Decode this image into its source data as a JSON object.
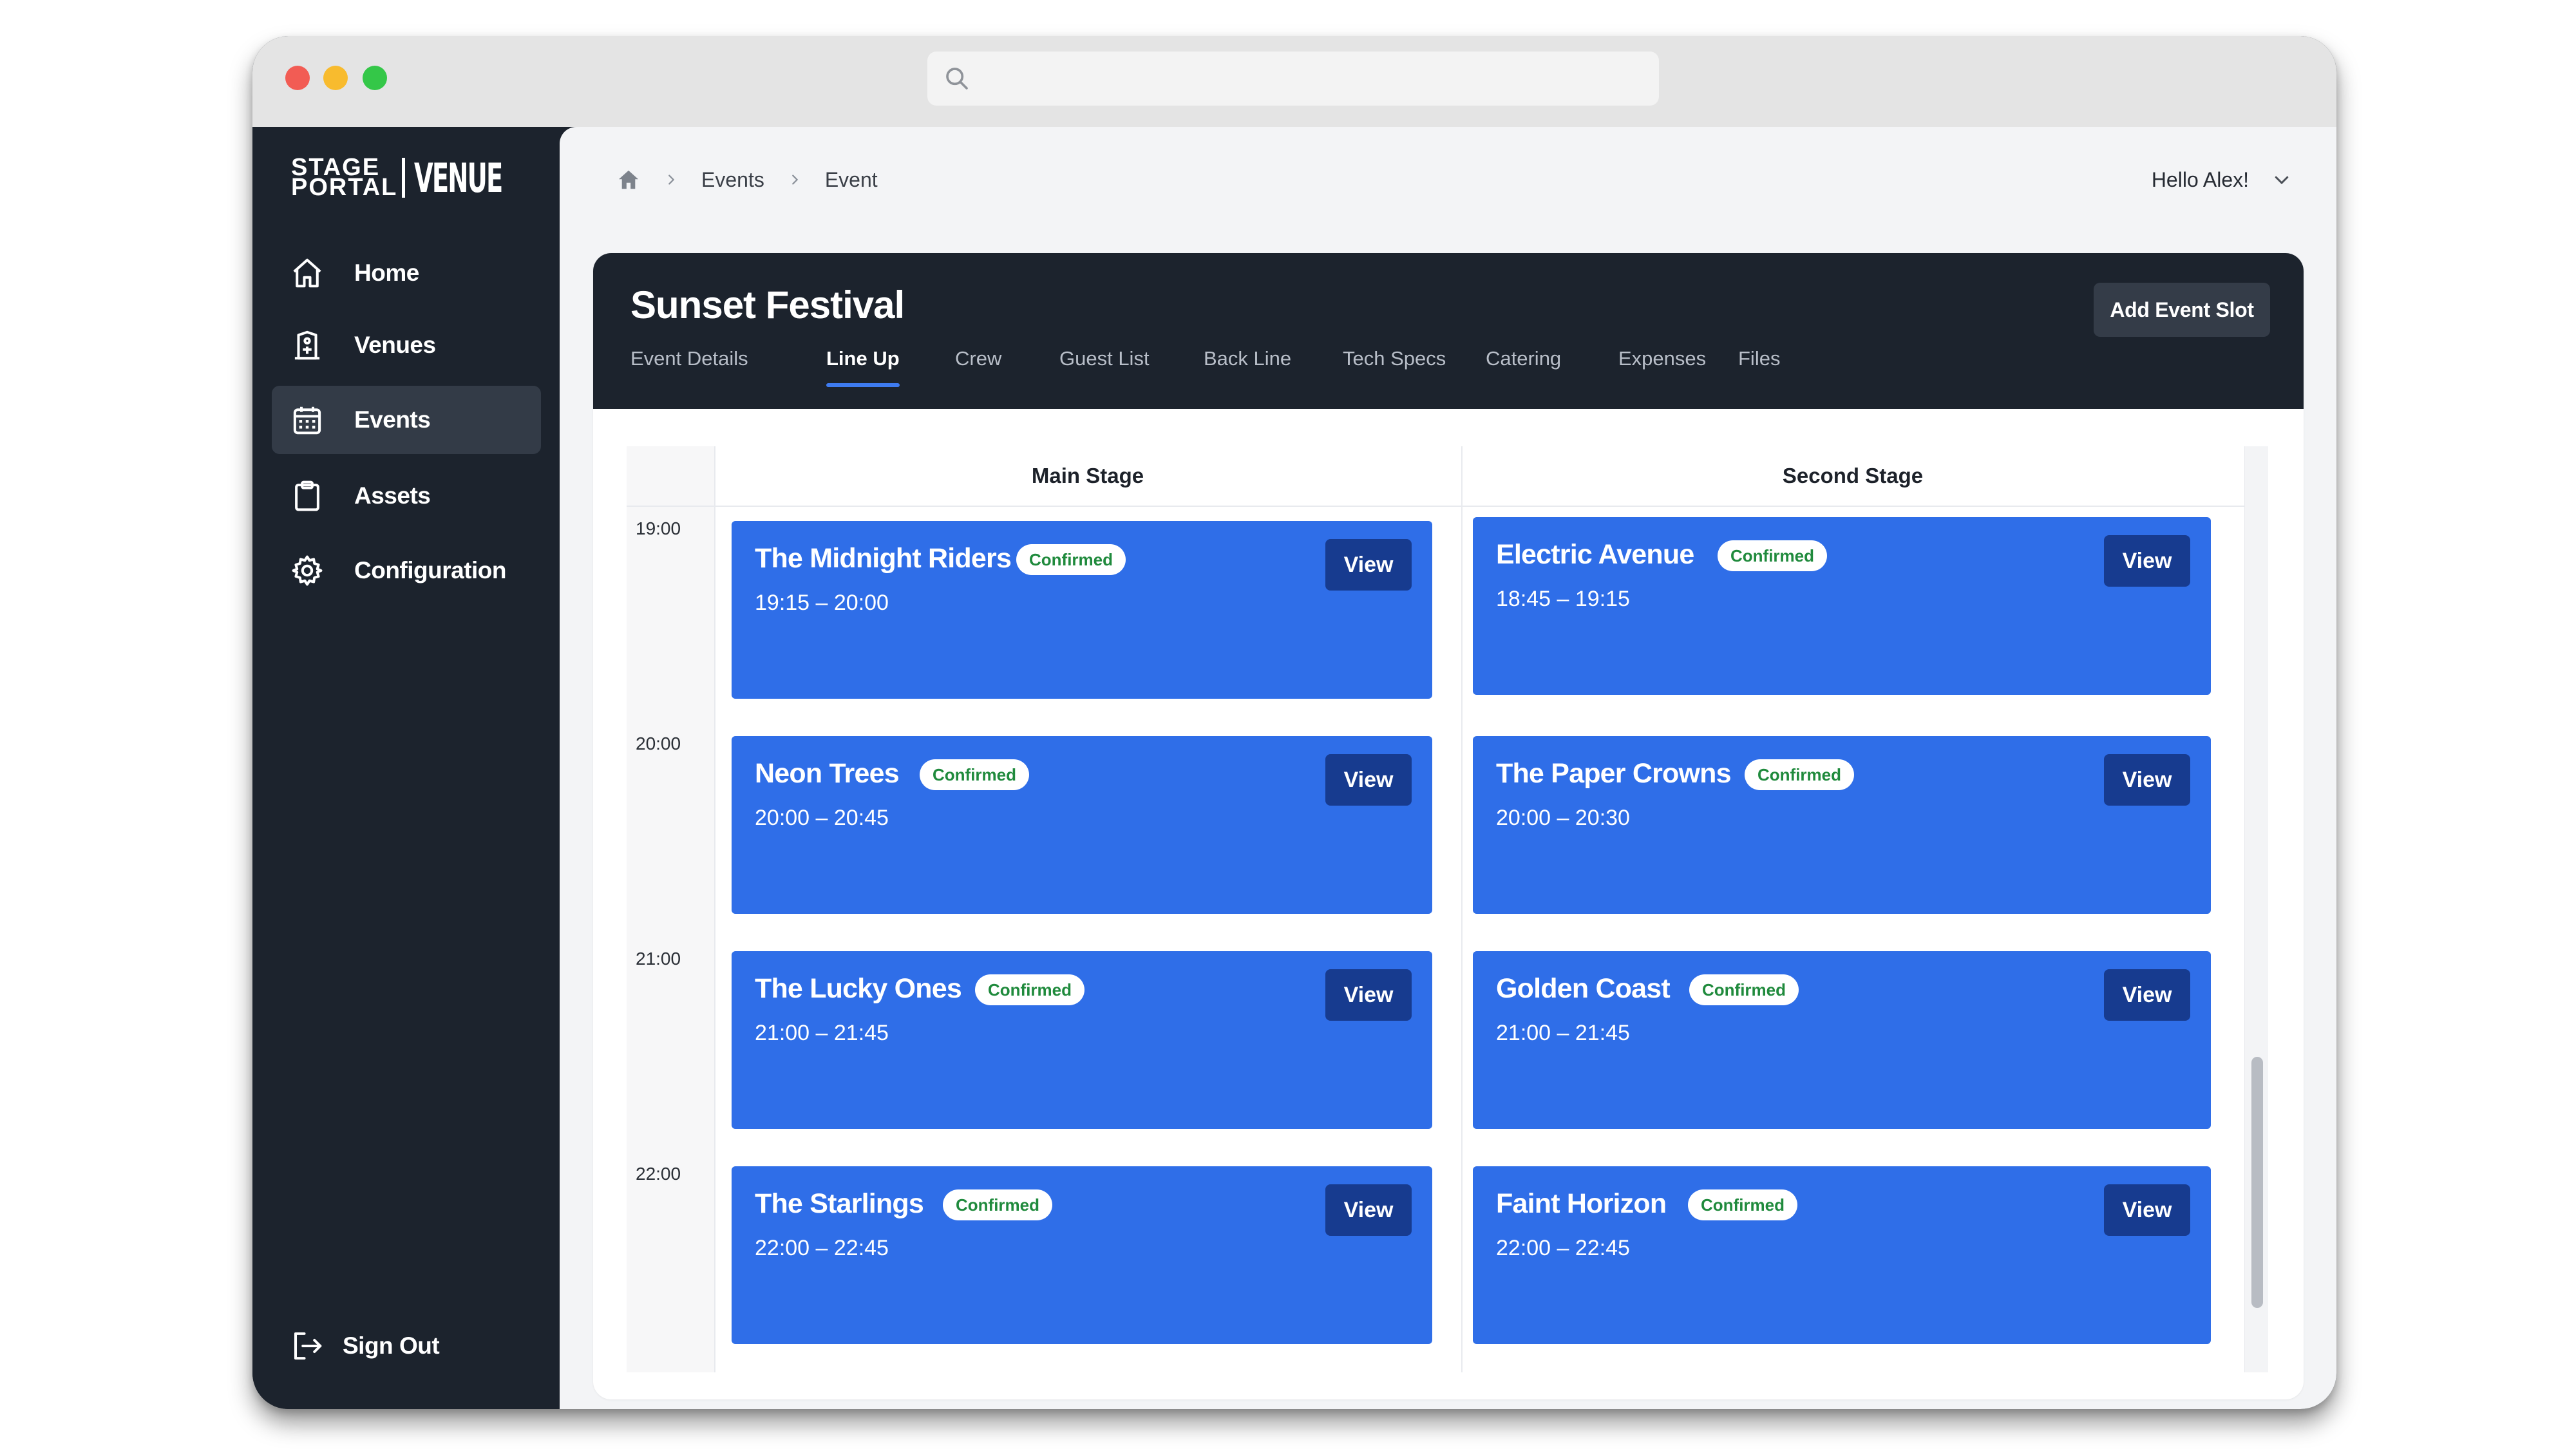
{
  "search": {
    "placeholder": ""
  },
  "brand": {
    "stage_line1": "STAGE",
    "stage_line2": "PORTAL",
    "venue": "VENUE"
  },
  "sidebar": {
    "items": [
      {
        "label": "Home",
        "icon": "home-icon"
      },
      {
        "label": "Venues",
        "icon": "building-icon"
      },
      {
        "label": "Events",
        "icon": "calendar-icon",
        "active": true
      },
      {
        "label": "Assets",
        "icon": "clipboard-icon"
      },
      {
        "label": "Configuration",
        "icon": "gear-icon"
      }
    ],
    "signout": {
      "label": "Sign Out",
      "icon": "sign-out-icon"
    }
  },
  "breadcrumb": {
    "home_icon": "home-icon",
    "items": [
      "Events",
      "Event"
    ]
  },
  "user": {
    "greeting": "Hello Alex!"
  },
  "event": {
    "title": "Sunset Festival",
    "add_slot_label": "Add Event Slot",
    "tabs": [
      "Event Details",
      "Line Up",
      "Crew",
      "Guest List",
      "Back Line",
      "Tech Specs",
      "Catering",
      "Expenses",
      "Files"
    ],
    "active_tab": "Line Up"
  },
  "schedule": {
    "stages": [
      "Main Stage",
      "Second Stage"
    ],
    "times": [
      "19:00",
      "20:00",
      "21:00",
      "22:00"
    ],
    "view_label": "View",
    "main_stage": [
      {
        "name": "The Midnight Riders",
        "status": "Confirmed",
        "time": "19:15 – 20:00"
      },
      {
        "name": "Neon Trees",
        "status": "Confirmed",
        "time": "20:00 – 20:45"
      },
      {
        "name": "The Lucky Ones",
        "status": "Confirmed",
        "time": "21:00 – 21:45"
      },
      {
        "name": "The Starlings",
        "status": "Confirmed",
        "time": "22:00 – 22:45"
      }
    ],
    "second_stage": [
      {
        "name": "Electric Avenue",
        "status": "Confirmed",
        "time": "18:45 – 19:15"
      },
      {
        "name": "The Paper Crowns",
        "status": "Confirmed",
        "time": "20:00 – 20:30"
      },
      {
        "name": "Golden Coast",
        "status": "Confirmed",
        "time": "21:00 – 21:45"
      },
      {
        "name": "Faint Horizon",
        "status": "Confirmed",
        "time": "22:00 – 22:45"
      }
    ]
  },
  "colors": {
    "sidebar_bg": "#1c232d",
    "slot_blue": "#2f6ee8",
    "view_button": "#173b8f",
    "confirmed_text": "#1f8a3c",
    "tab_underline": "#3e7bf0"
  }
}
